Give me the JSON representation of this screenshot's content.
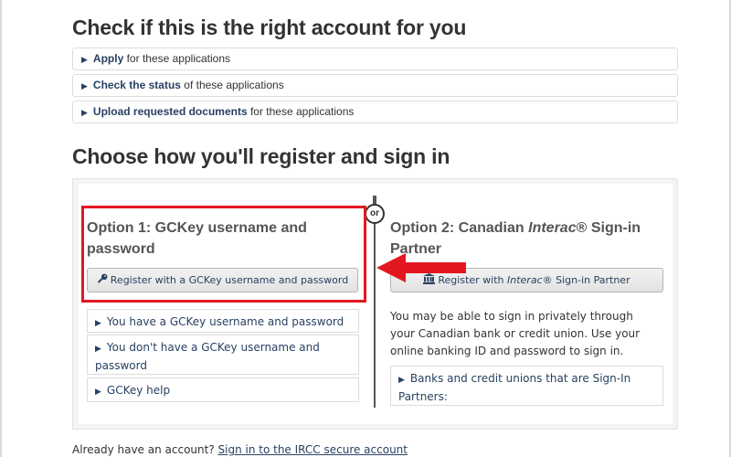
{
  "check_section": {
    "title": "Check if this is the right account for you",
    "items": [
      {
        "bold": "Apply",
        "rest": " for these applications"
      },
      {
        "bold": "Check the status",
        "rest": " of these applications"
      },
      {
        "bold": "Upload requested documents",
        "rest": " for these applications"
      }
    ]
  },
  "register_section": {
    "title": "Choose how you'll register and sign in",
    "or_label": "or",
    "option1": {
      "heading": "Option 1: GCKey username and password",
      "button_label": "Register with a GCKey username and password",
      "items": [
        "You have a GCKey username and password",
        "You don't have a GCKey username and password",
        "GCKey help"
      ]
    },
    "option2": {
      "heading_prefix": "Option 2: Canadian ",
      "heading_italic": "Interac",
      "heading_suffix": "® Sign-in Partner",
      "button_prefix": "Register with ",
      "button_italic": "Interac",
      "button_suffix": "® Sign-in Partner",
      "description": "You may be able to sign in privately through your Canadian bank or credit union. Use your online banking ID and password to sign in.",
      "items": [
        "Banks and credit unions that are Sign-In Partners:"
      ]
    }
  },
  "footer": {
    "prefix": "Already have an account? ",
    "link": "Sign in to the IRCC secure account"
  },
  "icons": {
    "collapsed": "triangle-right-icon",
    "gckey": "key-icon",
    "bank": "bank-icon",
    "annotation": "red-arrow-icon"
  },
  "colors": {
    "link": "#284162",
    "highlight": "#e3171f",
    "heading": "#333333"
  }
}
